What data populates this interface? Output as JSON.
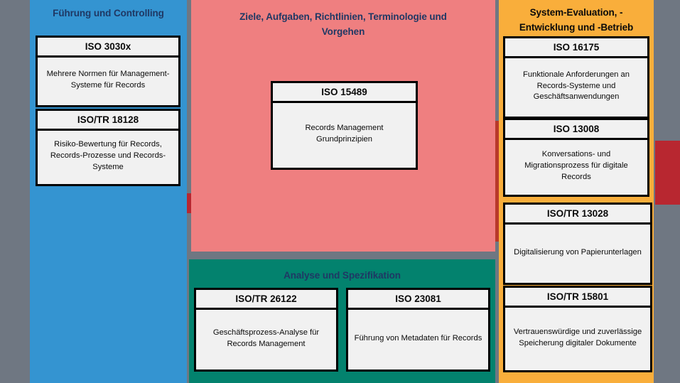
{
  "colors": {
    "page_background": "#6f7782",
    "leadership_panel": "#3494d1",
    "goals_panel": "#ef7f80",
    "evaluation_panel": "#f9ae3b",
    "analysis_panel": "#03826e",
    "accent_red": "#b82730",
    "heading_navy": "#1f3864",
    "card_background": "#f1f1f1",
    "card_border": "#000000"
  },
  "panels": {
    "leadership": {
      "heading": "Führung und Controlling",
      "cards": [
        {
          "title": "ISO 3030x",
          "body": "Mehrere Normen für Management-Systeme für Records"
        },
        {
          "title": "ISO/TR 18128",
          "body": "Risiko-Bewertung für Records, Records-Prozesse und Records-Systeme"
        }
      ]
    },
    "goals": {
      "heading": "Ziele, Aufgaben, Richtlinien, Terminologie und Vorgehen",
      "cards": [
        {
          "title": "ISO 15489",
          "body": "Records Management Grundprinzipien"
        }
      ]
    },
    "evaluation": {
      "heading": "System-Evaluation, -Entwicklung und -Betrieb",
      "cards": [
        {
          "title": "ISO 16175",
          "body": "Funktionale Anforderungen an Records-Systeme und Geschäftsanwendungen"
        },
        {
          "title": "ISO 13008",
          "body": "Konversations- und Migrationsprozess für digitale Records"
        },
        {
          "title": "ISO/TR 13028",
          "body": "Digitalisierung von Papierunterlagen"
        },
        {
          "title": "ISO/TR 15801",
          "body": "Vertrauenswürdige und zuverlässige Speicherung digitaler Dokumente"
        }
      ]
    },
    "analysis": {
      "heading": "Analyse und Spezifikation",
      "cards": [
        {
          "title": "ISO/TR 26122",
          "body": "Geschäftsprozess-Analyse für Records Management"
        },
        {
          "title": "ISO 23081",
          "body": "Führung von Metadaten für Records"
        }
      ]
    }
  }
}
